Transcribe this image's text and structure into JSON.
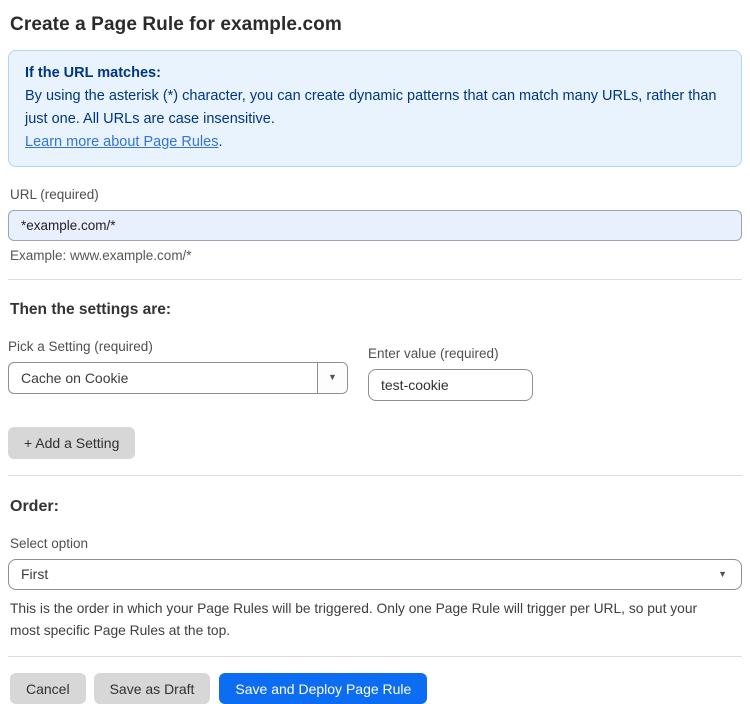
{
  "page": {
    "title": "Create a Page Rule for example.com"
  },
  "info_box": {
    "heading": "If the URL matches:",
    "body": "By using the asterisk (*) character, you can create dynamic patterns that can match many URLs, rather than just one. All URLs are case insensitive.",
    "link_label": "Learn more about Page Rules",
    "link_suffix": "."
  },
  "url_field": {
    "label": "URL (required)",
    "value": "*example.com/*",
    "example": "Example: www.example.com/*"
  },
  "settings_section": {
    "heading": "Then the settings are:",
    "setting_picker": {
      "label": "Pick a Setting (required)",
      "selected_value": "Cache on Cookie"
    },
    "value_field": {
      "label": "Enter value (required)",
      "value": "test-cookie"
    },
    "add_button_label": "+ Add a Setting"
  },
  "order_section": {
    "heading": "Order:",
    "select_label": "Select option",
    "selected_option": "First",
    "help_text": "This is the order in which your Page Rules will be triggered. Only one Page Rule will trigger per URL, so put your most specific Page Rules at the top."
  },
  "footer": {
    "cancel_label": "Cancel",
    "save_draft_label": "Save as Draft",
    "save_deploy_label": "Save and Deploy Page Rule"
  },
  "icons": {
    "dropdown_arrow": "▼"
  },
  "colors": {
    "info_box_bg": "#e9f3fd",
    "info_box_border": "#b0d6f5",
    "info_box_text": "#003681",
    "link": "#3574d4",
    "url_input_bg": "#e8f0fe",
    "primary_button_bg": "#0c6cf2",
    "primary_button_text": "#ffffff",
    "gray_button_bg": "#d7d7d7"
  }
}
